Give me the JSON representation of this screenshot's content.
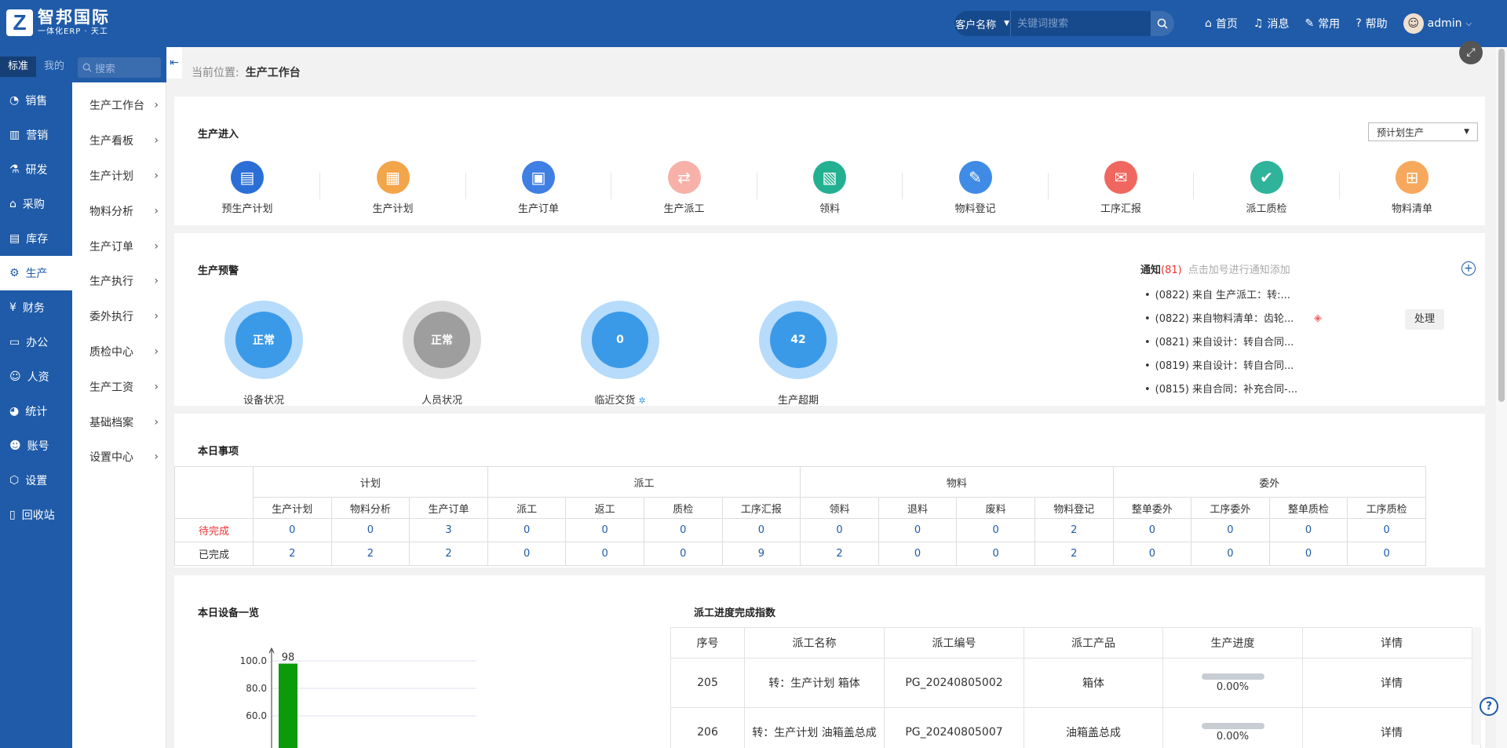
{
  "brand": {
    "logo_letter": "Z",
    "name": "智邦国际",
    "sub": "一体化ERP · 天工"
  },
  "search": {
    "select_label": "客户名称",
    "placeholder": "关键词搜索"
  },
  "topnav": [
    {
      "label": "首页",
      "icon": "home-icon"
    },
    {
      "label": "消息",
      "icon": "bell-icon"
    },
    {
      "label": "常用",
      "icon": "wrench-icon"
    },
    {
      "label": "帮助",
      "icon": "help-icon"
    }
  ],
  "user": {
    "name": "admin"
  },
  "sidebar": {
    "tabs": [
      "标准",
      "我的"
    ],
    "items": [
      {
        "label": "销售",
        "icon": "chart-icon"
      },
      {
        "label": "营销",
        "icon": "bar-icon"
      },
      {
        "label": "研发",
        "icon": "rd-icon"
      },
      {
        "label": "采购",
        "icon": "basket-icon"
      },
      {
        "label": "库存",
        "icon": "warehouse-icon"
      },
      {
        "label": "生产",
        "icon": "production-icon"
      },
      {
        "label": "财务",
        "icon": "yen-icon"
      },
      {
        "label": "办公",
        "icon": "briefcase-icon"
      },
      {
        "label": "人资",
        "icon": "person-icon"
      },
      {
        "label": "统计",
        "icon": "pie-icon"
      },
      {
        "label": "账号",
        "icon": "account-icon"
      },
      {
        "label": "设置",
        "icon": "settings-icon"
      },
      {
        "label": "回收站",
        "icon": "trash-icon"
      }
    ]
  },
  "submenu": {
    "search_placeholder": "搜索",
    "items": [
      "生产工作台",
      "生产看板",
      "生产计划",
      "物料分析",
      "生产订单",
      "生产执行",
      "委外执行",
      "质检中心",
      "生产工资",
      "基础档案",
      "设置中心"
    ]
  },
  "breadcrumb": {
    "prefix": "当前位置:",
    "current": "生产工作台"
  },
  "entry": {
    "title": "生产进入",
    "dropdown": "预计划生产",
    "items": [
      {
        "label": "预生产计划",
        "icon": "plan-doc-icon",
        "color": "#2b6fd6"
      },
      {
        "label": "生产计划",
        "icon": "calendar-add-icon",
        "color": "#f3a54a"
      },
      {
        "label": "生产订单",
        "icon": "clipboard-icon",
        "color": "#3f7fe3"
      },
      {
        "label": "生产派工",
        "icon": "swap-icon",
        "color": "#f7b1a8"
      },
      {
        "label": "领料",
        "icon": "box-icon",
        "color": "#23b091"
      },
      {
        "label": "物料登记",
        "icon": "register-icon",
        "color": "#3f8be6"
      },
      {
        "label": "工序汇报",
        "icon": "mail-icon",
        "color": "#f0675f"
      },
      {
        "label": "派工质检",
        "icon": "shield-check-icon",
        "color": "#2fb39a"
      },
      {
        "label": "物料清单",
        "icon": "tree-icon",
        "color": "#f6a85c"
      }
    ]
  },
  "warning": {
    "title": "生产预警",
    "gauges": [
      {
        "value": "正常",
        "label": "设备状况",
        "ring": "#b6dbfb",
        "fill": "#3b9ae8"
      },
      {
        "value": "正常",
        "label": "人员状况",
        "ring": "#dddddd",
        "fill": "#9e9e9e"
      },
      {
        "value": "0",
        "label": "临近交货",
        "ring": "#b6dbfb",
        "fill": "#3b9ae8"
      },
      {
        "value": "42",
        "label": "生产超期",
        "ring": "#b6dbfb",
        "fill": "#3b9ae8"
      }
    ]
  },
  "notice": {
    "title": "通知",
    "count": "(81)",
    "hint": "点击加号进行通知添加",
    "items": [
      "(0822) 来自 生产派工：转:...",
      "(0822) 来自物料清单：齿轮...",
      "(0821) 来自设计：转自合同...",
      "(0819) 来自设计：转自合同...",
      "(0815) 来自合同：补充合同-..."
    ],
    "action": "处理"
  },
  "today": {
    "title": "本日事项",
    "groups": [
      {
        "label": "计划",
        "span": 3
      },
      {
        "label": "派工",
        "span": 4
      },
      {
        "label": "物料",
        "span": 4
      },
      {
        "label": "委外",
        "span": 4
      }
    ],
    "columns": [
      "生产计划",
      "物料分析",
      "生产订单",
      "派工",
      "返工",
      "质检",
      "工序汇报",
      "领料",
      "退料",
      "废料",
      "物料登记",
      "整单委外",
      "工序委外",
      "整单质检",
      "工序质检"
    ],
    "rows": [
      {
        "label": "待完成",
        "values": [
          "0",
          "0",
          "3",
          "0",
          "0",
          "0",
          "0",
          "0",
          "0",
          "0",
          "2",
          "0",
          "0",
          "0",
          "0"
        ]
      },
      {
        "label": "已完成",
        "values": [
          "2",
          "2",
          "2",
          "0",
          "0",
          "0",
          "9",
          "2",
          "0",
          "0",
          "2",
          "0",
          "0",
          "0",
          "0"
        ]
      }
    ]
  },
  "equipment": {
    "title": "本日设备一览",
    "chart_data": {
      "type": "bar",
      "values": [
        98
      ],
      "data_labels": [
        "98"
      ],
      "yticks": [
        "100.0",
        "80.0",
        "60.0"
      ],
      "color": "#0a9a0a"
    }
  },
  "progress": {
    "title": "派工进度完成指数",
    "headers": [
      "序号",
      "派工名称",
      "派工编号",
      "派工产品",
      "生产进度",
      "详情"
    ],
    "rows": [
      {
        "no": "205",
        "name": "转：生产计划 箱体",
        "code": "PG_20240805002",
        "product": "箱体",
        "progress": "0.00%",
        "detail": "详情"
      },
      {
        "no": "206",
        "name": "转：生产计划 油箱盖总成",
        "code": "PG_20240805007",
        "product": "油箱盖总成",
        "progress": "0.00%",
        "detail": "详情"
      }
    ]
  }
}
